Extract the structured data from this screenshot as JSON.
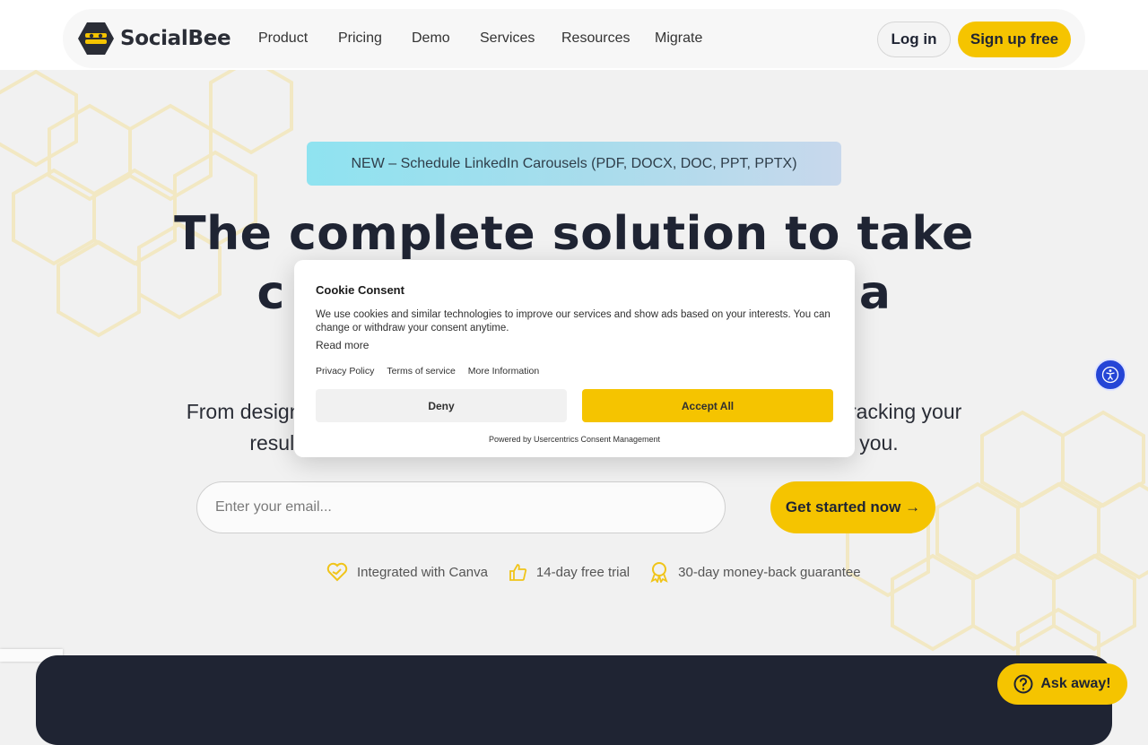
{
  "brand": {
    "name": "SocialBee",
    "accent_color": "#f5c400",
    "dark_color": "#1f2433"
  },
  "nav": {
    "items": [
      {
        "label": "Product"
      },
      {
        "label": "Pricing"
      },
      {
        "label": "Demo"
      },
      {
        "label": "Services"
      },
      {
        "label": "Resources"
      },
      {
        "label": "Migrate"
      }
    ],
    "login_label": "Log in",
    "signup_label": "Sign up free"
  },
  "hero": {
    "announcement": "NEW – Schedule LinkedIn Carousels (PDF, DOCX, DOC, PPT, PPTX)",
    "title_line1": "The complete solution to take",
    "title_line2_left": "c",
    "title_line2_right": "a",
    "subtitle_line1_left": "From designi",
    "subtitle_line1_right": "tracking your",
    "subtitle_line2_left": "resul",
    "subtitle_line2_right": "you.",
    "email_placeholder": "Enter your email...",
    "cta_label": "Get started now →",
    "features": [
      {
        "icon": "canva-heart-icon",
        "label": "Integrated with Canva"
      },
      {
        "icon": "thumbs-up-icon",
        "label": "14-day free trial"
      },
      {
        "icon": "award-badge-icon",
        "label": "30-day money-back guarantee"
      }
    ]
  },
  "cookie": {
    "title": "Cookie Consent",
    "text": "We use cookies and similar technologies to improve our services and show ads based on your interests. You can change or withdraw your consent anytime.",
    "read_more": "Read more",
    "links": [
      "Privacy Policy",
      "Terms of service",
      "More Information"
    ],
    "deny_label": "Deny",
    "accept_label": "Accept All",
    "powered_by": "Powered by Usercentrics Consent Management"
  },
  "widgets": {
    "accessibility_icon": "accessibility-icon",
    "chat_label": "Ask away!",
    "chat_icon": "question-circle-icon"
  }
}
